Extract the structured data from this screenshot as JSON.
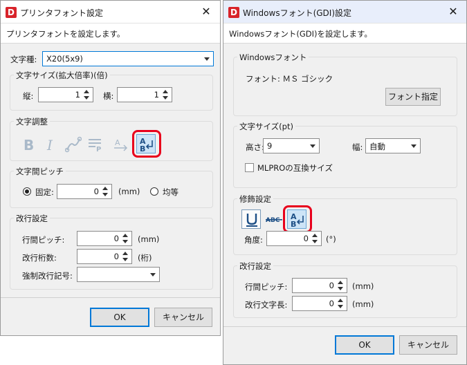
{
  "printer": {
    "title": "プリンタフォント設定",
    "description": "プリンタフォントを設定します。",
    "char_type": {
      "label": "文字種:",
      "value": "X20(5x9)"
    },
    "char_size": {
      "group_label": "文字サイズ(拡大倍率)(倍)",
      "vertical_label": "縦:",
      "vertical_value": "1",
      "horizontal_label": "横:",
      "horizontal_value": "1"
    },
    "char_adjust": {
      "group_label": "文字調整"
    },
    "pitch": {
      "group_label": "文字間ピッチ",
      "fixed_label": "固定:",
      "fixed_value": "0",
      "unit": "(mm)",
      "equal_label": "均等"
    },
    "linefeed": {
      "group_label": "改行設定",
      "line_pitch_label": "行間ピッチ:",
      "line_pitch_value": "0",
      "line_pitch_unit": "(mm)",
      "digits_label": "改行桁数:",
      "digits_value": "0",
      "digits_unit": "(桁)",
      "forced_label": "強制改行記号:",
      "forced_value": ""
    },
    "ok_label": "OK",
    "cancel_label": "キャンセル"
  },
  "gdi": {
    "title": "Windowsフォント(GDI)設定",
    "description": "Windowsフォント(GDI)を設定します。",
    "font_group": {
      "group_label": "Windowsフォント",
      "font_text": "フォント:  ＭＳ ゴシック",
      "specify_label": "フォント指定"
    },
    "size_group": {
      "group_label": "文字サイズ(pt)",
      "height_label": "高さ:",
      "height_value": "9",
      "width_label": "幅:",
      "width_value": "自動",
      "compat_label": "MLPROの互換サイズ"
    },
    "decor": {
      "group_label": "修飾設定",
      "angle_label": "角度:",
      "angle_value": "0",
      "angle_unit": "(°)"
    },
    "linefeed": {
      "group_label": "改行設定",
      "line_pitch_label": "行間ピッチ:",
      "line_pitch_value": "0",
      "line_pitch_unit": "(mm)",
      "line_len_label": "改行文字長:",
      "line_len_value": "0",
      "line_len_unit": "(mm)"
    },
    "ok_label": "OK",
    "cancel_label": "キャンセル"
  },
  "app_icon_letter": "D",
  "close_glyph": "✕",
  "colors": {
    "accent": "#0078d7",
    "highlight": "#e8001c",
    "app_icon": "#d8232a"
  }
}
